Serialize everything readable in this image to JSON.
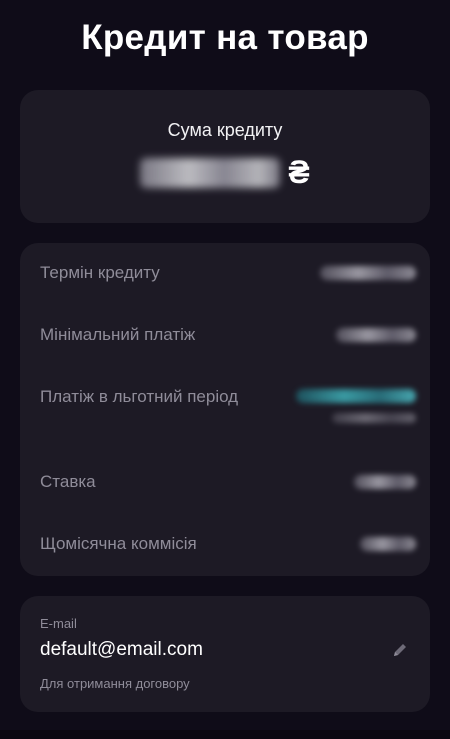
{
  "header": {
    "title": "Кредит на товар"
  },
  "amount": {
    "label": "Сума кредиту",
    "currency": "₴"
  },
  "details": {
    "rows": [
      {
        "label": "Термін кредиту"
      },
      {
        "label": "Мінімальний платіж"
      },
      {
        "label": "Платіж в льготний період"
      },
      {
        "label": "Ставка"
      },
      {
        "label": "Щомісячна коммісія"
      }
    ]
  },
  "email": {
    "label": "E-mail",
    "value": "default@email.com",
    "hint": "Для отримання договору",
    "edit_icon": "pencil-icon"
  },
  "colors": {
    "background": "#0f0c18",
    "card": "#1d1a25",
    "muted_text": "#8f8c99",
    "accent_teal": "#3fb0b8"
  }
}
